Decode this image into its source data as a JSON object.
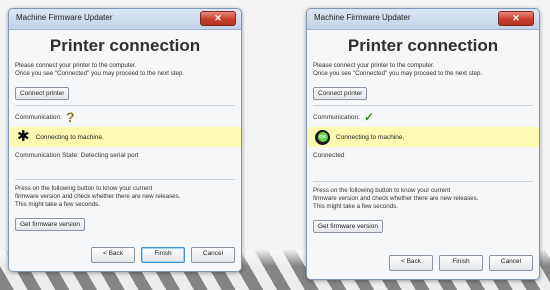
{
  "windows": [
    {
      "title": "Machine Firmware Updater",
      "heading": "Printer connection",
      "instructions": [
        "Please connect your printer to the computer.",
        "Once you see \"Connected\" you may proceed to the next step."
      ],
      "connect_button": "Connect printer",
      "communication_label": "Communication:",
      "status_icon": "question-icon",
      "status_message": "Connecting to machine.",
      "state_text": "Communication State: Detecting serial port",
      "firmware_info": [
        "Press on the following button to know your current",
        "firmware version and check whether there are new releases.",
        "This might take a few seconds."
      ],
      "firmware_button": "Get firmware version",
      "buttons": {
        "back": "< Back",
        "finish": "Finish",
        "cancel": "Cancel"
      }
    },
    {
      "title": "Machine Firmware Updater",
      "heading": "Printer connection",
      "instructions": [
        "Please connect your printer to the computer.",
        "Once you see \"Connected\" you may proceed to the next step."
      ],
      "connect_button": "Connect printer",
      "communication_label": "Communication:",
      "status_icon": "check-icon",
      "status_badge": "OK",
      "status_message": "Connecting to machine.",
      "state_text": "Connected",
      "firmware_info": [
        "Press on the following button to know your current",
        "firmware version and check whether there are new releases.",
        "This might take a few seconds."
      ],
      "firmware_button": "Get firmware version",
      "buttons": {
        "back": "< Back",
        "finish": "Finish",
        "cancel": "Cancel"
      }
    }
  ],
  "colors": {
    "highlight": "#fbfab0",
    "close_button": "#c8402d",
    "ok_green": "#6bd14b"
  }
}
